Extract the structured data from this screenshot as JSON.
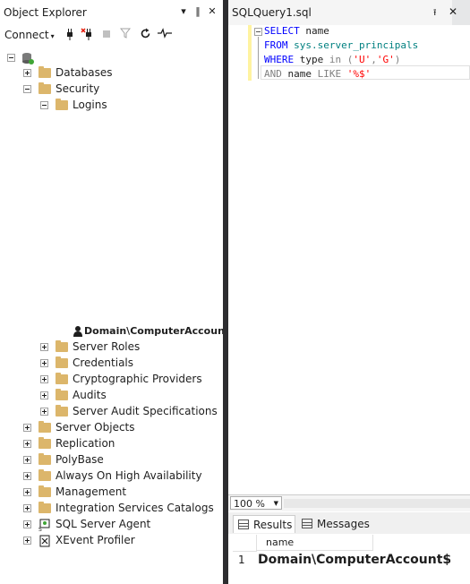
{
  "object_explorer": {
    "title": "Object Explorer",
    "title_buttons": [
      "▾",
      "‖",
      "✕"
    ],
    "toolbar": {
      "connect_label": "Connect",
      "connect_caret": "▾"
    },
    "tree": {
      "databases": "Databases",
      "security": "Security",
      "logins": "Logins",
      "login_item": "Domain\\ComputerAccount$",
      "server_roles": "Server Roles",
      "credentials": "Credentials",
      "cryptographic_providers": "Cryptographic Providers",
      "audits": "Audits",
      "server_audit_specifications": "Server Audit Specifications",
      "server_objects": "Server Objects",
      "replication": "Replication",
      "polybase": "PolyBase",
      "always_on": "Always On High Availability",
      "management": "Management",
      "integration_services": "Integration Services Catalogs",
      "sql_server_agent": "SQL Server Agent",
      "xevent_profiler": "XEvent Profiler"
    }
  },
  "query_editor": {
    "tab_title": "SQLQuery1.sql",
    "tab_pin": "⭱",
    "tab_close": "✕",
    "code": {
      "l1_kw": "SELECT",
      "l1_rest": " name",
      "l2_kw": "FROM",
      "l2_obj": " sys.server_principals",
      "l3_kw": "WHERE",
      "l3_col": " type",
      "l3_in": " in",
      "l3_open": " (",
      "l3_s1": "'U'",
      "l3_comma": ",",
      "l3_s2": "'G'",
      "l3_close": ")",
      "l4_and": "AND",
      "l4_col": " name",
      "l4_like": " LIKE",
      "l4_str": " '%$'"
    },
    "zoom": "100 %",
    "zoom_caret": "▼"
  },
  "results": {
    "tab_results": "Results",
    "tab_messages": "Messages",
    "column_header": "name",
    "rows": [
      {
        "row_number": "1",
        "name": "Domain\\ComputerAccount$"
      }
    ]
  },
  "colors": {
    "splitter": "#2d2d30",
    "keyword": "#0000ff",
    "string": "#ff0000",
    "system_object": "#008080",
    "folder": "#dcb66b",
    "line_change_marker": "#fff3a0"
  }
}
